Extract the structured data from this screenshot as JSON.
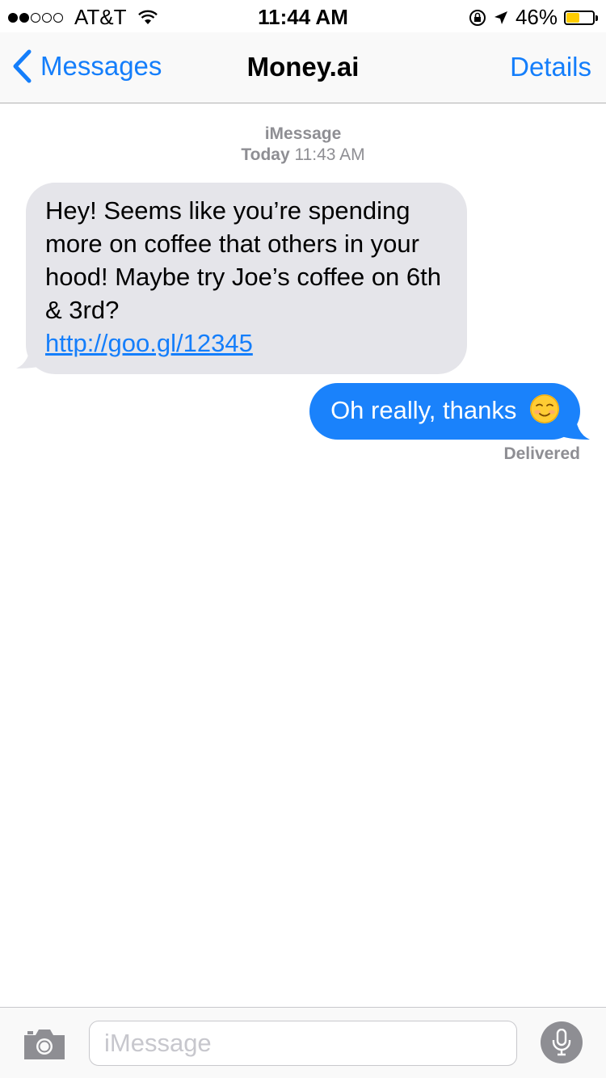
{
  "status_bar": {
    "carrier": "AT&T",
    "signal_full_dots": 2,
    "signal_total_dots": 5,
    "time": "11:44 AM",
    "battery_percent_label": "46%",
    "battery_level": 0.46
  },
  "nav": {
    "back_label": "Messages",
    "title": "Money.ai",
    "details_label": "Details"
  },
  "conversation": {
    "service": "iMessage",
    "timestamp_day": "Today",
    "timestamp_time": "11:43 AM",
    "incoming_message": "Hey! Seems like you’re spending more on coffee that others in your hood! Maybe try Joe’s coffee on 6th & 3rd?",
    "incoming_link": "http://goo.gl/12345",
    "outgoing_message": "Oh really, thanks",
    "outgoing_emoji": "smiling-face-emoji",
    "delivery_status": "Delivered"
  },
  "input_bar": {
    "placeholder": "iMessage"
  },
  "colors": {
    "accent": "#147efb",
    "outgoing_bubble": "#1a82fb",
    "incoming_bubble": "#e5e5ea",
    "secondary_text": "#8e8e93",
    "battery_fill": "#ffcc00"
  }
}
